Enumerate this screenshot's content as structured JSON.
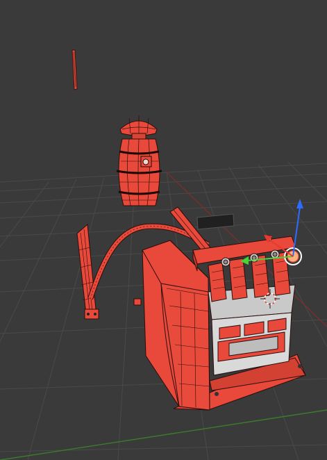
{
  "viewport": {
    "background": "#3a3a3a",
    "grid_color": "#484848",
    "axis_x_color": "#8b2f2f",
    "axis_y_color": "#3a7d2a",
    "mesh_fill": "#e8493a",
    "mesh_wire": "#3a1410",
    "selected_outline": "#ffb27a",
    "metal_light": "#cfcfcf",
    "metal_dark": "#8c8c8c",
    "gizmo": {
      "x_color": "#e83a2e",
      "y_color": "#4cd137",
      "z_color": "#2e6bff",
      "center_color": "#ffffff"
    },
    "objects": [
      "lamp-mesh",
      "bucket-mesh",
      "hose-arm-mesh",
      "machine-body-mesh",
      "gauge-panel-mesh",
      "sign-plate-mesh",
      "3d-cursor"
    ]
  }
}
